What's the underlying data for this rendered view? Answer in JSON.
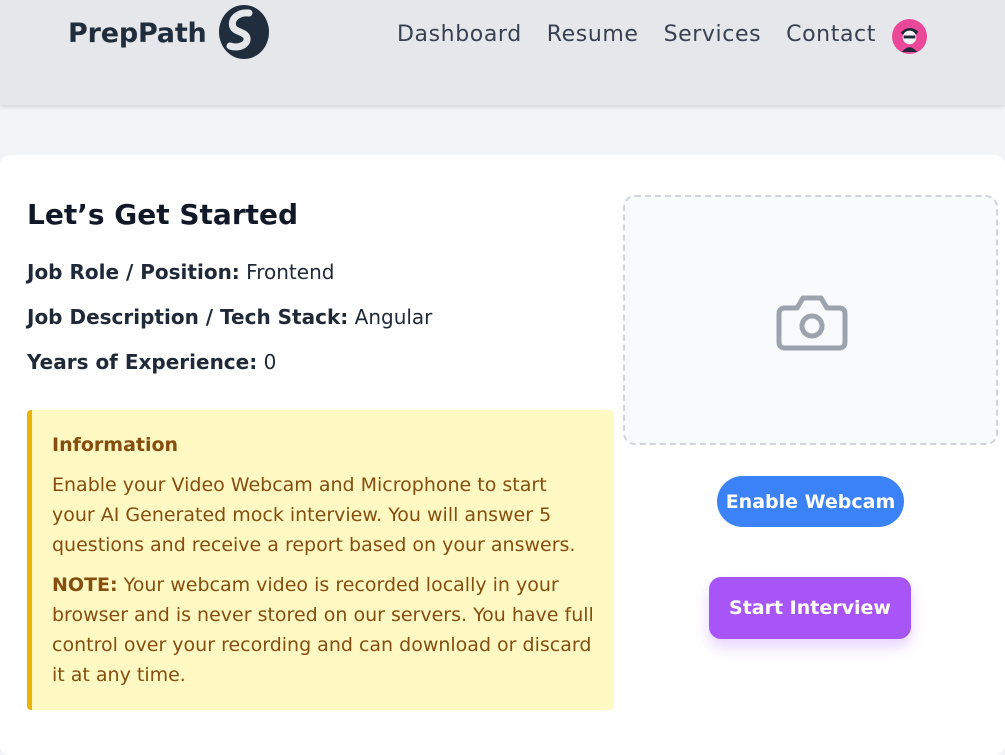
{
  "header": {
    "brand": "PrepPath",
    "nav": [
      "Dashboard",
      "Resume",
      "Services",
      "Contact"
    ]
  },
  "main": {
    "title": "Let’s Get Started",
    "fields": [
      {
        "label": "Job Role / Position:",
        "value": "Frontend"
      },
      {
        "label": "Job Description / Tech Stack:",
        "value": "Angular"
      },
      {
        "label": "Years of Experience:",
        "value": "0"
      }
    ],
    "info": {
      "title": "Information",
      "text": "Enable your Video Webcam and Microphone to start your AI Generated mock interview. You will answer 5 questions and receive a report based on your answers.",
      "note_label": "NOTE:",
      "note_text": " Your webcam video is recorded locally in your browser and is never stored on our servers. You have full control over your recording and can download or discard it at any time."
    }
  },
  "webcam": {
    "icon": "camera-icon",
    "enable_label": "Enable Webcam",
    "start_label": "Start Interview"
  },
  "colors": {
    "enable_button": "#3b82f6",
    "start_button": "#a855f7",
    "info_background": "#fef9c3",
    "info_border": "#eab308",
    "info_text": "#854d0e"
  }
}
